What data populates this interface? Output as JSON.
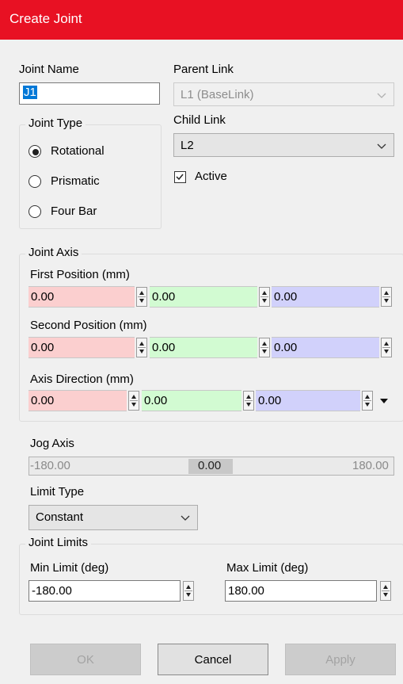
{
  "window": {
    "title": "Create Joint"
  },
  "joint_name": {
    "label": "Joint Name",
    "value": "J1"
  },
  "parent_link": {
    "label": "Parent Link",
    "value": "L1 (BaseLink)"
  },
  "child_link": {
    "label": "Child Link",
    "value": "L2"
  },
  "active": {
    "label": "Active",
    "checked": true
  },
  "joint_type": {
    "title": "Joint Type",
    "options": [
      "Rotational",
      "Prismatic",
      "Four Bar"
    ],
    "selected": "Rotational"
  },
  "joint_axis": {
    "title": "Joint Axis",
    "first_position": {
      "label": "First Position (mm)",
      "x": "0.00",
      "y": "0.00",
      "z": "0.00"
    },
    "second_position": {
      "label": "Second Position (mm)",
      "x": "0.00",
      "y": "0.00",
      "z": "0.00"
    },
    "axis_direction": {
      "label": "Axis Direction (mm)",
      "x": "0.00",
      "y": "0.00",
      "z": "0.00"
    }
  },
  "jog_axis": {
    "label": "Jog Axis",
    "min": "-180.00",
    "value": "0.00",
    "max": "180.00"
  },
  "limit_type": {
    "label": "Limit Type",
    "value": "Constant"
  },
  "joint_limits": {
    "title": "Joint Limits",
    "min_label": "Min Limit (deg)",
    "min_value": "-180.00",
    "max_label": "Max Limit (deg)",
    "max_value": "180.00"
  },
  "buttons": {
    "ok": "OK",
    "cancel": "Cancel",
    "apply": "Apply"
  },
  "colors": {
    "titlebar": "#e81123",
    "x_field": "#fbcfcf",
    "y_field": "#d2fbd2",
    "z_field": "#d1d1fb"
  }
}
